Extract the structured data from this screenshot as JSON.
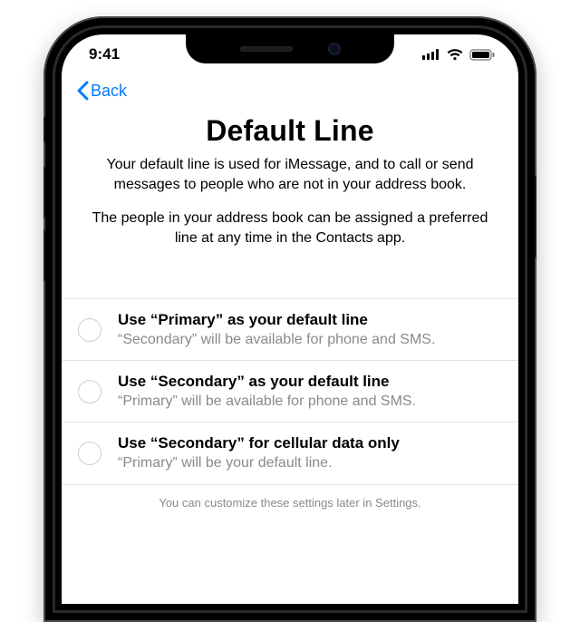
{
  "status": {
    "time": "9:41"
  },
  "nav": {
    "back_label": "Back"
  },
  "page": {
    "title": "Default Line",
    "paragraph1": "Your default line is used for iMessage, and to call or send messages to people who are not in your address book.",
    "paragraph2": "The people in your address book can be assigned a preferred line at any time in the Contacts app."
  },
  "options": [
    {
      "title": "Use “Primary” as your default line",
      "subtitle": "“Secondary” will be available for phone and SMS."
    },
    {
      "title": "Use “Secondary” as your default line",
      "subtitle": "“Primary” will be available for phone and SMS."
    },
    {
      "title": "Use “Secondary” for cellular data only",
      "subtitle": "“Primary” will be your default line."
    }
  ],
  "footer": {
    "note": "You can customize these settings later in Settings."
  }
}
